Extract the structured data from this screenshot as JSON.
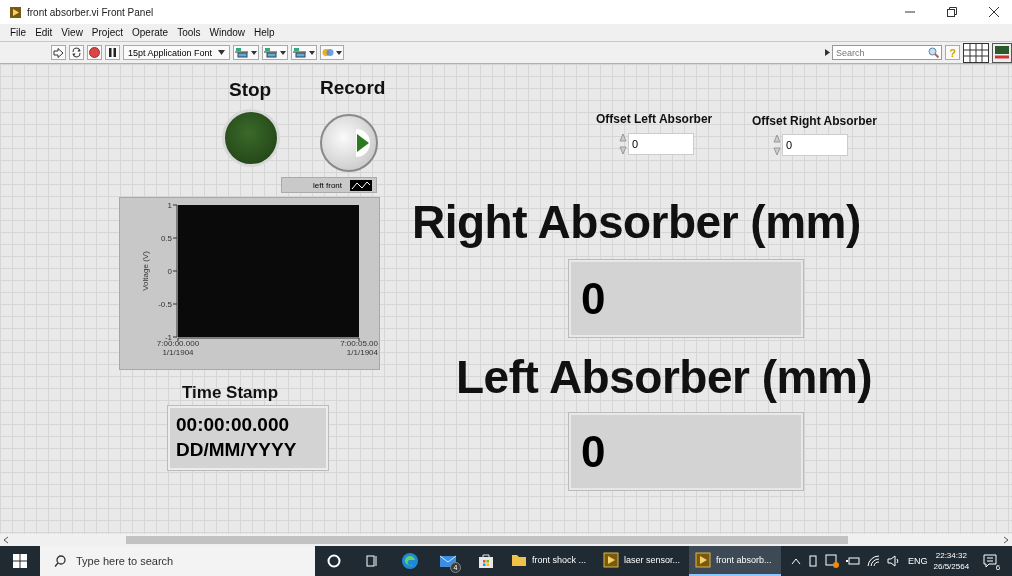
{
  "window": {
    "title": "front absorber.vi Front Panel"
  },
  "menu": [
    "File",
    "Edit",
    "View",
    "Project",
    "Operate",
    "Tools",
    "Window",
    "Help"
  ],
  "toolbar": {
    "font": "15pt Application Font",
    "search": {
      "placeholder": "Search"
    },
    "help": "?"
  },
  "panel": {
    "stop": {
      "label": "Stop",
      "on": false
    },
    "record": {
      "label": "Record",
      "on": false
    },
    "graph": {
      "chart_data": {
        "type": "line",
        "ylabel": "Voltage (V)",
        "ylim": [
          -1,
          1
        ],
        "yticks": [
          {
            "value": 1,
            "label": "1"
          },
          {
            "value": 0.5,
            "label": "0.5"
          },
          {
            "value": 0,
            "label": "0"
          },
          {
            "value": -0.5,
            "label": "-0.5"
          },
          {
            "value": -1,
            "label": "-1"
          }
        ],
        "categories": [
          "7:00:00.000\n1/1/1904",
          "7:00:05.00\n1/1/1904"
        ],
        "series": [
          {
            "name": "left front",
            "color": "#ffffff",
            "values": [
              null,
              null
            ]
          }
        ]
      }
    },
    "offsets": [
      {
        "label": "Offset Left Absorber",
        "value": "0"
      },
      {
        "label": "Offset Right Absorber",
        "value": "0"
      }
    ],
    "indicators": [
      {
        "label": "Right Absorber (mm)",
        "value": "0"
      },
      {
        "label": "Left Absorber (mm)",
        "value": "0"
      }
    ],
    "time_stamp": {
      "label": "Time Stamp",
      "time": "00:00:00.000",
      "date": "DD/MM/YYYY"
    }
  },
  "taskbar": {
    "search": {
      "placeholder": "Type here to search"
    },
    "mail_badge": "4",
    "apps": [
      {
        "label": "front shock ...",
        "kind": "folder",
        "selected": false
      },
      {
        "label": "laser sensor...",
        "kind": "labview",
        "selected": false
      },
      {
        "label": "front absorb...",
        "kind": "labview",
        "selected": true
      }
    ],
    "language": "ENG",
    "time": "22:34:32",
    "date": "26/5/2564",
    "notifications": "6"
  }
}
